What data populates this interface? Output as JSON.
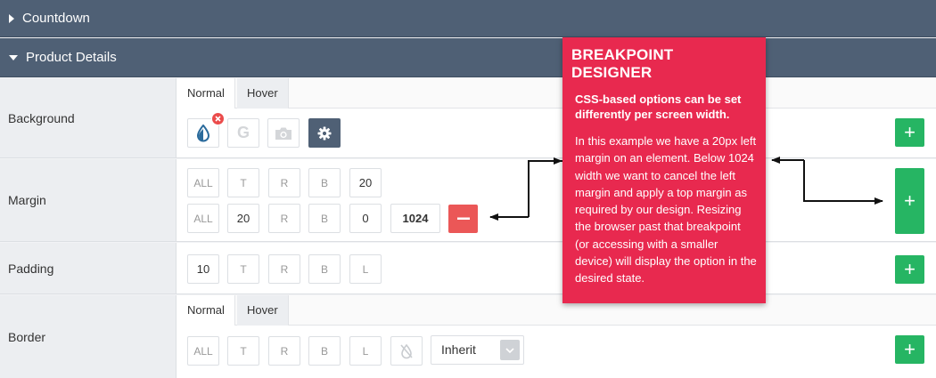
{
  "sections": {
    "countdown": "Countdown",
    "product_details": "Product Details"
  },
  "background": {
    "label": "Background",
    "tabs": [
      "Normal",
      "Hover"
    ],
    "google_glyph": "G"
  },
  "margin": {
    "label": "Margin",
    "row1": [
      "ALL",
      "T",
      "R",
      "B",
      "20"
    ],
    "row2": [
      "ALL",
      "20",
      "R",
      "B",
      "0"
    ],
    "breakpoint": "1024"
  },
  "padding": {
    "label": "Padding",
    "boxes": [
      "10",
      "T",
      "R",
      "B",
      "L"
    ]
  },
  "border": {
    "label": "Border",
    "tabs": [
      "Normal",
      "Hover"
    ],
    "boxes": [
      "ALL",
      "T",
      "R",
      "B",
      "L"
    ],
    "style_value": "Inherit"
  },
  "tooltip": {
    "title": "BREAKPOINT DESIGNER",
    "subtitle": "CSS-based options can be set differently per screen width.",
    "body": "In this example we have a 20px left margin on an element. Below 1024 width we want to cancel the left margin and apply a top margin as required by our design. Resizing the browser past that breakpoint (or accessing with a smaller device) will display the option in the desired state."
  },
  "colors": {
    "header": "#4f6075",
    "add_button": "#26b563",
    "remove_button": "#eb5757",
    "tooltip": "#e8294f"
  },
  "icons": [
    "color-drop-icon",
    "remove-badge-icon",
    "google-icon",
    "camera-icon",
    "gear-icon",
    "plus-icon",
    "minus-icon",
    "no-style-icon",
    "chevron-down-icon"
  ]
}
